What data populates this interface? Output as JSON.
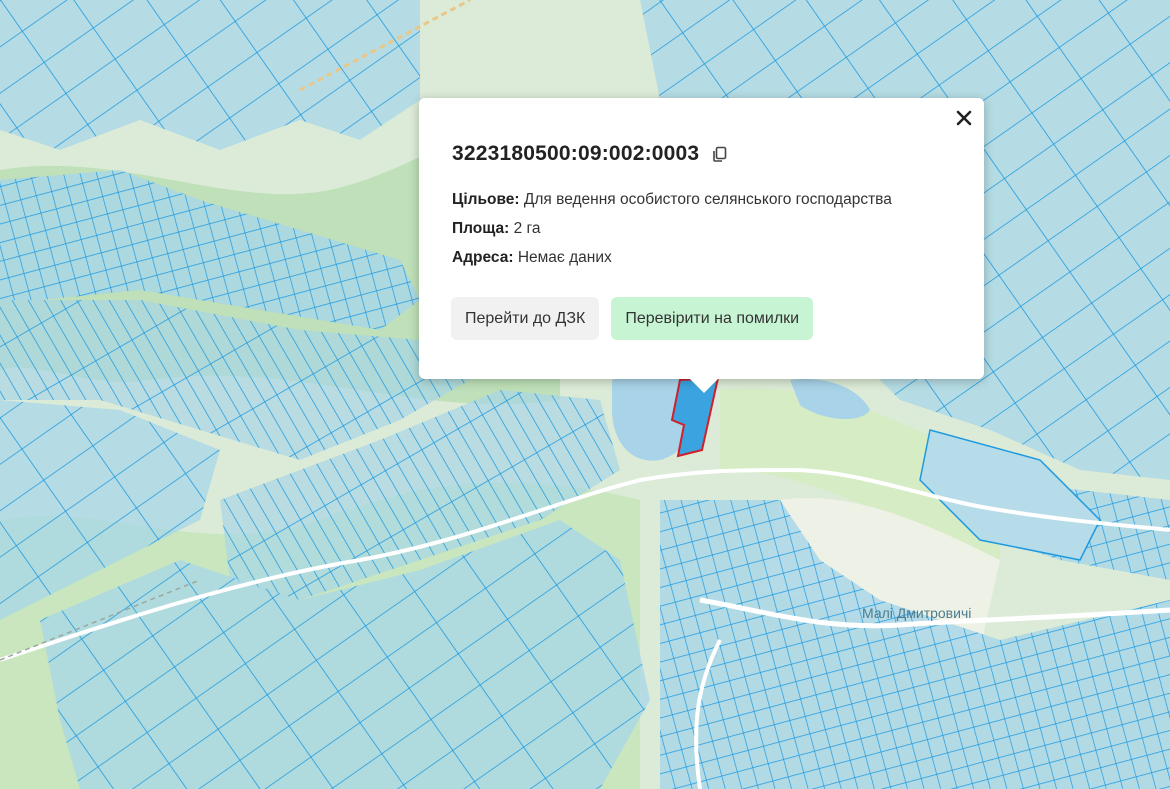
{
  "popup": {
    "cadastral_number": "3223180500:09:002:0003",
    "purpose_label": "Цільове:",
    "purpose_value": "Для ведення особистого селянського господарства",
    "area_label": "Площа:",
    "area_value": "2 га",
    "address_label": "Адреса:",
    "address_value": "Немає даних",
    "goto_button": "Перейти до ДЗК",
    "check_button": "Перевірити на помилки"
  },
  "map": {
    "village_label": "Малі Дмитровичі",
    "colors": {
      "background": "#dcebd7",
      "forest": "#bfe0b8",
      "meadow": "#d6ecc4",
      "water": "#a8d3e8",
      "parcel_fill": "#a8d6e8",
      "parcel_stroke": "#1e9ae0",
      "road": "#ffffff",
      "selected_parcel_stroke": "#d0202a",
      "selected_parcel_fill": "#3aa3e0"
    }
  }
}
